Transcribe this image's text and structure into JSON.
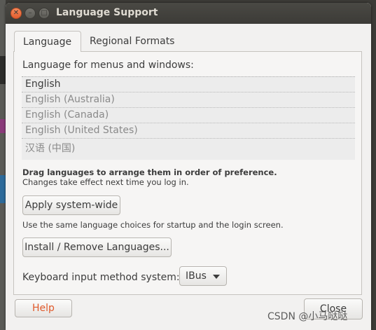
{
  "window": {
    "title": "Language Support",
    "controls": {
      "close": "✕",
      "minimize": "–",
      "maximize": "□"
    }
  },
  "tabs": [
    {
      "label": "Language",
      "active": true
    },
    {
      "label": "Regional Formats",
      "active": false
    }
  ],
  "language_section": {
    "label": "Language for menus and windows:",
    "languages": [
      "English",
      "English (Australia)",
      "English (Canada)",
      "English (United States)",
      "汉语 (中国)"
    ]
  },
  "hint": {
    "bold": "Drag languages to arrange them in order of preference.",
    "sub": "Changes take effect next time you log in."
  },
  "apply": {
    "label": "Apply system-wide",
    "note": "Use the same language choices for startup and the login screen."
  },
  "install": {
    "label": "Install / Remove Languages..."
  },
  "keyboard": {
    "label": "Keyboard input method system:",
    "selected": "IBus"
  },
  "footer": {
    "help": "Help",
    "close": "Close"
  },
  "watermark": "CSDN @小马哒哒",
  "colors": {
    "accent": "#e05a2b",
    "titlebar": "#3c3b37",
    "window_bg": "#f2f1f0"
  }
}
